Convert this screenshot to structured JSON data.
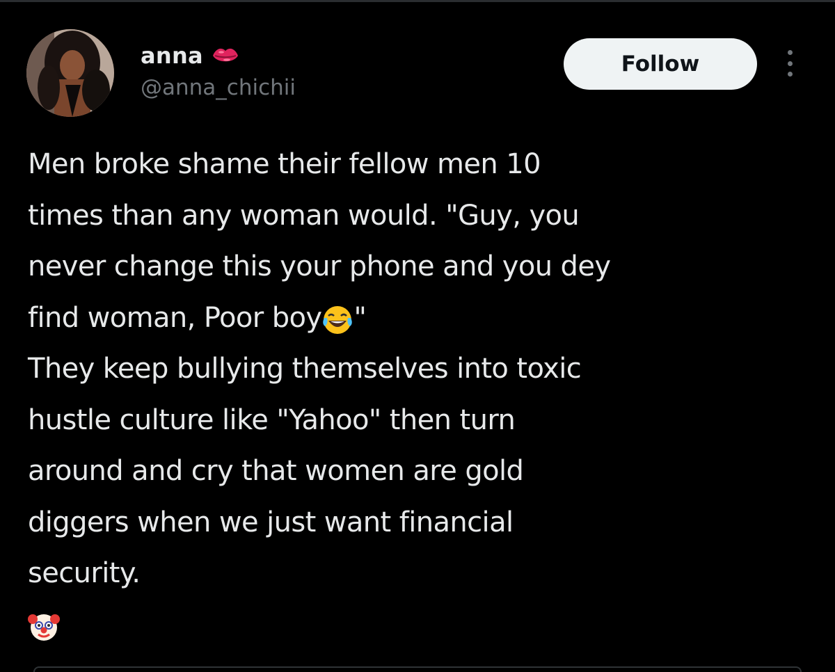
{
  "author": {
    "display_name": "anna",
    "name_emoji": "lips-icon",
    "handle": "@anna_chichii",
    "avatar": "profile-photo"
  },
  "actions": {
    "follow_label": "Follow",
    "more_icon": "more-vertical-icon"
  },
  "tweet": {
    "line_1": "Men broke shame their fellow men 10",
    "line_2": "times than any woman would. \"Guy, you",
    "line_3": "never change this your phone and you dey",
    "line_4_text": "find woman, Poor boy",
    "line_4_end": "\"",
    "line_4_emoji": "face-with-tears-of-joy-emoji",
    "line_5": "They keep bullying themselves into toxic",
    "line_6": "hustle culture like \"Yahoo\" then turn",
    "line_7": "around and cry that women are gold",
    "line_8": "diggers when we just want financial",
    "line_9": "security.",
    "line_10_emoji": "clown-face-emoji"
  },
  "colors": {
    "background": "#000000",
    "text_primary": "#e7e9ea",
    "text_secondary": "#71767b",
    "follow_bg": "#eff3f4",
    "follow_text": "#0f1419",
    "lips": "#e0245e"
  }
}
